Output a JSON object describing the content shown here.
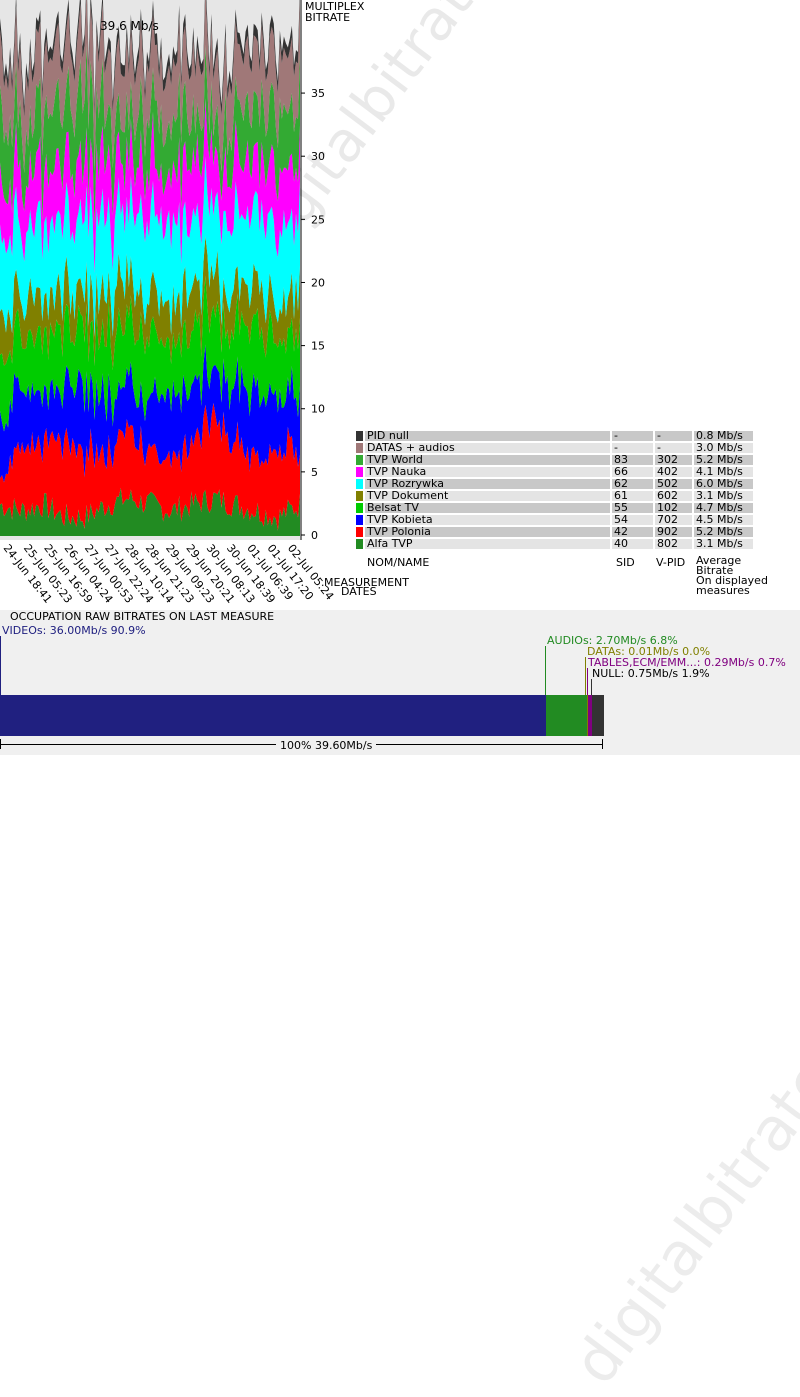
{
  "header": {
    "total_bitrate": "39.6 Mb/s",
    "axis_title_line1": "MULTIPLEX",
    "axis_title_line2": "BITRATE"
  },
  "watermark": "digitalbitrate.com",
  "colors": {
    "pid_null": "#333333",
    "datas_audios": "#a07878",
    "tvp_world": "#33aa33",
    "tvp_nauka": "#ff00ff",
    "tvp_rozrywka": "#00ffff",
    "tvp_dokument": "#808000",
    "belsat_tv": "#00cc00",
    "tvp_kobieta": "#0000ff",
    "tvp_polonia": "#ff0000",
    "alfa_tvp": "#228b22",
    "videos_bar": "#202080",
    "audios_bar": "#228b22",
    "tables_bar": "#800080",
    "null_bar": "#333333"
  },
  "chart_data": {
    "type": "area",
    "stacked": true,
    "x_tick_labels": [
      "24-Jun 18:41",
      "25-Jun 05:23",
      "25-Jun 16:59",
      "26-Jun 04:24",
      "27-Jun 00:53",
      "27-Jun 22:24",
      "28-Jun 10:14",
      "28-Jun 21:23",
      "29-Jun 09:23",
      "29-Jun 20:21",
      "30-Jun 08:13",
      "30-Jun 18:39",
      "01-Jul 06:39",
      "01-Jul 17:20",
      "02-Jul 05:24"
    ],
    "xlabel_line1": "MEASUREMENT",
    "xlabel_line2": "DATES",
    "y_ticks": [
      "0",
      "5",
      "10",
      "15",
      "20",
      "25",
      "30",
      "35"
    ],
    "ylim": [
      0,
      39.6
    ],
    "series": [
      {
        "name": "Alfa TVP",
        "color": "#228b22",
        "approx_values": [
          2.5,
          2.0,
          2.5,
          1.5,
          1.5,
          2.5,
          3.0,
          2.5,
          2.0,
          2.5,
          3.0,
          2.5,
          2.0,
          1.5,
          2.5
        ]
      },
      {
        "name": "TVP Polonia",
        "color": "#ff0000",
        "approx_values": [
          3.0,
          5.0,
          4.5,
          6.0,
          5.0,
          4.5,
          5.5,
          4.0,
          4.5,
          5.0,
          6.5,
          5.0,
          4.5,
          5.5,
          4.0
        ]
      },
      {
        "name": "TVP Kobieta",
        "color": "#0000ff",
        "approx_values": [
          4.5,
          5.0,
          4.0,
          4.5,
          5.0,
          4.5,
          4.0,
          4.5,
          5.0,
          4.5,
          4.0,
          4.5,
          5.0,
          4.5,
          4.5
        ]
      },
      {
        "name": "Belsat TV",
        "color": "#00cc00",
        "approx_values": [
          5.0,
          4.5,
          5.0,
          4.5,
          4.5,
          5.0,
          4.5,
          5.0,
          4.5,
          5.0,
          4.5,
          4.5,
          5.0,
          4.5,
          4.7
        ]
      },
      {
        "name": "TVP Dokument",
        "color": "#808000",
        "approx_values": [
          3.5,
          3.0,
          3.5,
          3.0,
          3.0,
          3.0,
          3.5,
          3.0,
          3.0,
          3.5,
          3.0,
          3.0,
          3.5,
          3.0,
          3.1
        ]
      },
      {
        "name": "TVP Rozrywka",
        "color": "#00ffff",
        "approx_values": [
          6.0,
          5.5,
          6.0,
          5.5,
          6.0,
          6.0,
          5.5,
          6.0,
          6.5,
          5.5,
          5.0,
          6.0,
          5.5,
          6.0,
          6.0
        ]
      },
      {
        "name": "TVP Nauka",
        "color": "#ff00ff",
        "approx_values": [
          4.0,
          4.5,
          4.0,
          4.5,
          4.0,
          4.5,
          4.0,
          4.5,
          4.0,
          4.5,
          4.0,
          4.5,
          4.0,
          4.5,
          4.1
        ]
      },
      {
        "name": "TVP World",
        "color": "#33aa33",
        "approx_values": [
          5.5,
          4.0,
          4.5,
          4.5,
          6.0,
          4.0,
          3.5,
          4.5,
          4.5,
          3.5,
          3.0,
          4.0,
          4.5,
          4.5,
          5.2
        ]
      },
      {
        "name": "DATAS + audios",
        "color": "#a07878",
        "approx_values": [
          4.4,
          4.4,
          4.4,
          4.4,
          4.4,
          4.4,
          4.4,
          4.4,
          4.4,
          4.4,
          4.4,
          4.4,
          4.4,
          4.4,
          4.4
        ]
      },
      {
        "name": "PID null",
        "color": "#333333",
        "approx_values": [
          0.9,
          0.9,
          0.9,
          0.9,
          0.9,
          0.9,
          0.9,
          0.9,
          0.9,
          0.9,
          0.9,
          0.9,
          0.9,
          0.9,
          0.9
        ]
      }
    ]
  },
  "legend": {
    "rows": [
      {
        "name": "PID null",
        "color": "#333333",
        "sid": "-",
        "vpid": "-",
        "bitrate": "0.8 Mb/s"
      },
      {
        "name": "DATAS + audios",
        "color": "#a07878",
        "sid": "-",
        "vpid": "-",
        "bitrate": "3.0 Mb/s"
      },
      {
        "name": "TVP World",
        "color": "#33aa33",
        "sid": "83",
        "vpid": "302",
        "bitrate": "5.2 Mb/s"
      },
      {
        "name": "TVP Nauka",
        "color": "#ff00ff",
        "sid": "66",
        "vpid": "402",
        "bitrate": "4.1 Mb/s"
      },
      {
        "name": "TVP Rozrywka",
        "color": "#00ffff",
        "sid": "62",
        "vpid": "502",
        "bitrate": "6.0 Mb/s"
      },
      {
        "name": "TVP Dokument",
        "color": "#808000",
        "sid": "61",
        "vpid": "602",
        "bitrate": "3.1 Mb/s"
      },
      {
        "name": "Belsat TV",
        "color": "#00cc00",
        "sid": "55",
        "vpid": "102",
        "bitrate": "4.7 Mb/s"
      },
      {
        "name": "TVP Kobieta",
        "color": "#0000ff",
        "sid": "54",
        "vpid": "702",
        "bitrate": "4.5 Mb/s"
      },
      {
        "name": "TVP Polonia",
        "color": "#ff0000",
        "sid": "42",
        "vpid": "902",
        "bitrate": "5.2 Mb/s"
      },
      {
        "name": "Alfa TVP",
        "color": "#228b22",
        "sid": "40",
        "vpid": "802",
        "bitrate": "3.1 Mb/s"
      }
    ],
    "col_name": "NOM/NAME",
    "col_sid": "SID",
    "col_vpid": "V-PID",
    "col_bitrate_1": "Average",
    "col_bitrate_2": "Bitrate",
    "col_bitrate_3": "On displayed",
    "col_bitrate_4": "measures"
  },
  "occupation": {
    "title": "OCCUPATION RAW BITRATES ON LAST MEASURE",
    "videos": "VIDEOs: 36.00Mb/s  90.9%",
    "audios": "AUDIOs: 2.70Mb/s  6.8%",
    "datas": "DATAs: 0.01Mb/s  0.0%",
    "tables": "TABLES,ECM/EMM...: 0.29Mb/s  0.7%",
    "null": "NULL: 0.75Mb/s  1.9%",
    "total": "100%  39.60Mb/s",
    "segments": [
      {
        "name": "VIDEOs",
        "value": 36.0,
        "color": "#202080"
      },
      {
        "name": "AUDIOs",
        "value": 2.7,
        "color": "#228b22"
      },
      {
        "name": "DATAs",
        "value": 0.01,
        "color": "#808000"
      },
      {
        "name": "TABLES,ECM/EMM...",
        "value": 0.29,
        "color": "#800080"
      },
      {
        "name": "NULL",
        "value": 0.75,
        "color": "#333333"
      }
    ]
  }
}
